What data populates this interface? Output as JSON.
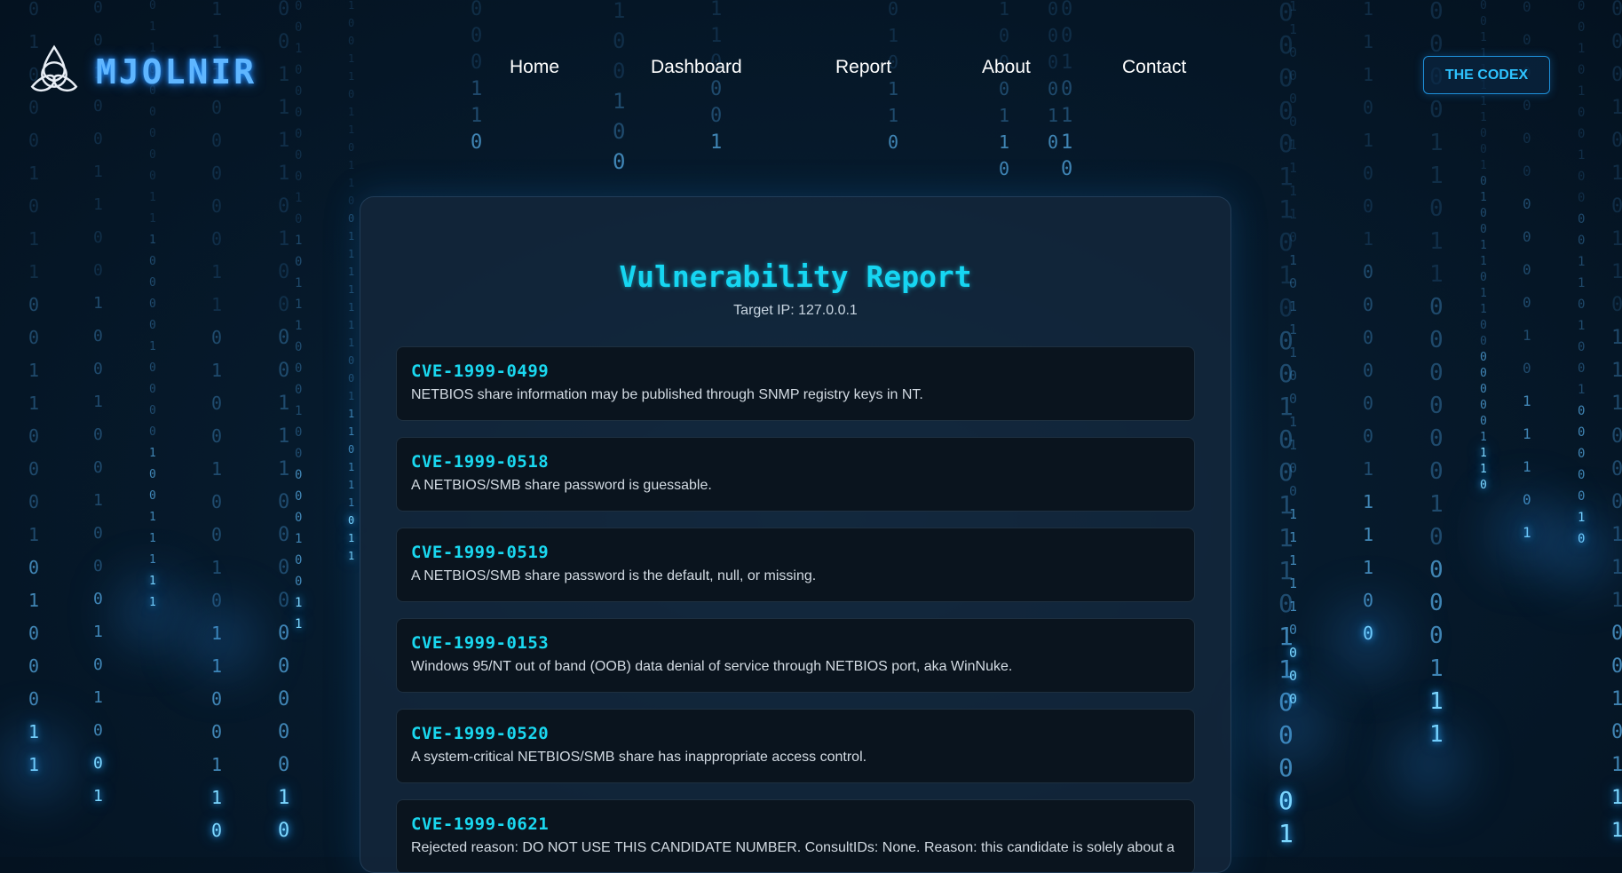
{
  "brand": {
    "name": "MJOLNIR",
    "logo_icon": "triquetra-icon"
  },
  "nav": {
    "items": [
      {
        "label": "Home"
      },
      {
        "label": "Dashboard"
      },
      {
        "label": "Report"
      },
      {
        "label": "About"
      },
      {
        "label": "Contact"
      }
    ]
  },
  "header": {
    "codex_button": "THE CODEX"
  },
  "report": {
    "title": "Vulnerability Report",
    "target": "Target IP: 127.0.0.1",
    "entries": [
      {
        "id": "CVE-1999-0499",
        "description": "NETBIOS share information may be published through SNMP registry keys in NT."
      },
      {
        "id": "CVE-1999-0518",
        "description": "A NETBIOS/SMB share password is guessable."
      },
      {
        "id": "CVE-1999-0519",
        "description": "A NETBIOS/SMB share password is the default, null, or missing."
      },
      {
        "id": "CVE-1999-0153",
        "description": "Windows 95/NT out of band (OOB) data denial of service through NETBIOS port, aka WinNuke."
      },
      {
        "id": "CVE-1999-0520",
        "description": "A system-critical NETBIOS/SMB share has inappropriate access control."
      },
      {
        "id": "CVE-1999-0621",
        "description": "Rejected reason: DO NOT USE THIS CANDIDATE NUMBER. ConsultIDs: None. Reason: this candidate is solely about a"
      }
    ]
  },
  "theme": {
    "accent": "#16d6f2",
    "brand_glow": "#5fb6ff",
    "background": "#061a2c"
  },
  "background_glyphs": [
    "0",
    "1"
  ]
}
